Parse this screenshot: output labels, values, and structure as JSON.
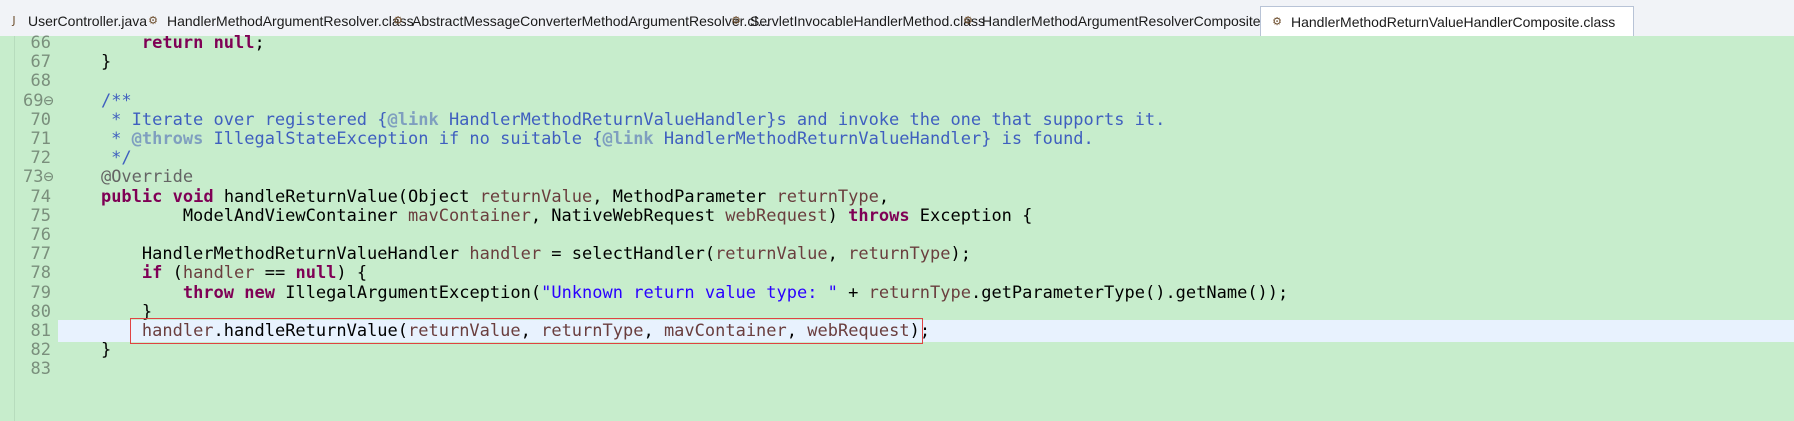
{
  "tabs": [
    {
      "label": "UserController.java",
      "icon": "java-file-icon"
    },
    {
      "label": "HandlerMethodArgumentResolver.class",
      "icon": "class-file-icon"
    },
    {
      "label": "AbstractMessageConverterMethodArgumentResolver.cl...",
      "icon": "class-file-icon"
    },
    {
      "label": "ServletInvocableHandlerMethod.class",
      "icon": "class-file-icon"
    },
    {
      "label": "HandlerMethodArgumentResolverComposite.class",
      "icon": "class-file-icon"
    },
    {
      "label": "HandlerMethodReturnValueHandlerComposite.class",
      "icon": "class-file-icon",
      "active": true
    }
  ],
  "lines": [
    {
      "n": "66",
      "segments": [
        {
          "t": "        "
        },
        {
          "t": "return",
          "c": "kw"
        },
        {
          "t": " "
        },
        {
          "t": "null",
          "c": "kw"
        },
        {
          "t": ";"
        }
      ]
    },
    {
      "n": "67",
      "segments": [
        {
          "t": "    }"
        }
      ]
    },
    {
      "n": "68",
      "segments": [
        {
          "t": ""
        }
      ]
    },
    {
      "n": "69⊖",
      "segments": [
        {
          "t": "    "
        },
        {
          "t": "/**",
          "c": "cm"
        }
      ]
    },
    {
      "n": "70",
      "segments": [
        {
          "t": "     * Iterate over registered {",
          "c": "cm"
        },
        {
          "t": "@link",
          "c": "tag"
        },
        {
          "t": " HandlerMethodReturnValueHandler}s and invoke the one that supports it.",
          "c": "cm"
        }
      ]
    },
    {
      "n": "71",
      "segments": [
        {
          "t": "     * ",
          "c": "cm"
        },
        {
          "t": "@throws",
          "c": "tag"
        },
        {
          "t": " IllegalStateException if no suitable {",
          "c": "cm"
        },
        {
          "t": "@link",
          "c": "tag"
        },
        {
          "t": " HandlerMethodReturnValueHandler} is found.",
          "c": "cm"
        }
      ]
    },
    {
      "n": "72",
      "segments": [
        {
          "t": "     */",
          "c": "cm"
        }
      ]
    },
    {
      "n": "73⊖",
      "segments": [
        {
          "t": "    "
        },
        {
          "t": "@Override",
          "c": "ann"
        }
      ]
    },
    {
      "n": "74",
      "segments": [
        {
          "t": "    "
        },
        {
          "t": "public",
          "c": "kw"
        },
        {
          "t": " "
        },
        {
          "t": "void",
          "c": "kw"
        },
        {
          "t": " handleReturnValue(Object "
        },
        {
          "t": "returnValue",
          "c": "var"
        },
        {
          "t": ", MethodParameter "
        },
        {
          "t": "returnType",
          "c": "var"
        },
        {
          "t": ","
        }
      ]
    },
    {
      "n": "75",
      "segments": [
        {
          "t": "            ModelAndViewContainer "
        },
        {
          "t": "mavContainer",
          "c": "var"
        },
        {
          "t": ", NativeWebRequest "
        },
        {
          "t": "webRequest",
          "c": "var"
        },
        {
          "t": ") "
        },
        {
          "t": "throws",
          "c": "kw"
        },
        {
          "t": " Exception {"
        }
      ]
    },
    {
      "n": "76",
      "segments": [
        {
          "t": ""
        }
      ]
    },
    {
      "n": "77",
      "segments": [
        {
          "t": "        HandlerMethodReturnValueHandler "
        },
        {
          "t": "handler",
          "c": "var"
        },
        {
          "t": " = selectHandler("
        },
        {
          "t": "returnValue",
          "c": "var"
        },
        {
          "t": ", "
        },
        {
          "t": "returnType",
          "c": "var"
        },
        {
          "t": ");"
        }
      ]
    },
    {
      "n": "78",
      "segments": [
        {
          "t": "        "
        },
        {
          "t": "if",
          "c": "kw"
        },
        {
          "t": " ("
        },
        {
          "t": "handler",
          "c": "var"
        },
        {
          "t": " == "
        },
        {
          "t": "null",
          "c": "kw"
        },
        {
          "t": ") {"
        }
      ]
    },
    {
      "n": "79",
      "segments": [
        {
          "t": "            "
        },
        {
          "t": "throw",
          "c": "kw"
        },
        {
          "t": " "
        },
        {
          "t": "new",
          "c": "kw"
        },
        {
          "t": " IllegalArgumentException("
        },
        {
          "t": "\"Unknown return value type: \"",
          "c": "str"
        },
        {
          "t": " + "
        },
        {
          "t": "returnType",
          "c": "var"
        },
        {
          "t": ".getParameterType().getName());"
        }
      ]
    },
    {
      "n": "80",
      "segments": [
        {
          "t": "        }"
        }
      ]
    },
    {
      "n": "81",
      "segments": [
        {
          "t": "        "
        },
        {
          "t": "handler",
          "c": "var"
        },
        {
          "t": ".handleReturnValue("
        },
        {
          "t": "returnValue",
          "c": "var"
        },
        {
          "t": ", "
        },
        {
          "t": "returnType",
          "c": "var"
        },
        {
          "t": ", "
        },
        {
          "t": "mavContainer",
          "c": "var"
        },
        {
          "t": ", "
        },
        {
          "t": "webRequest",
          "c": "var"
        },
        {
          "t": ");"
        }
      ],
      "current": true
    },
    {
      "n": "82",
      "segments": [
        {
          "t": "    }"
        }
      ]
    },
    {
      "n": "83",
      "segments": [
        {
          "t": ""
        }
      ]
    }
  ],
  "colors": {
    "editor_bg": "#c7edcc",
    "keyword": "#7f0055",
    "comment": "#3f5fbf",
    "variable": "#6a3e3e",
    "string": "#2a00ff",
    "highlight_box": "#e04343"
  }
}
